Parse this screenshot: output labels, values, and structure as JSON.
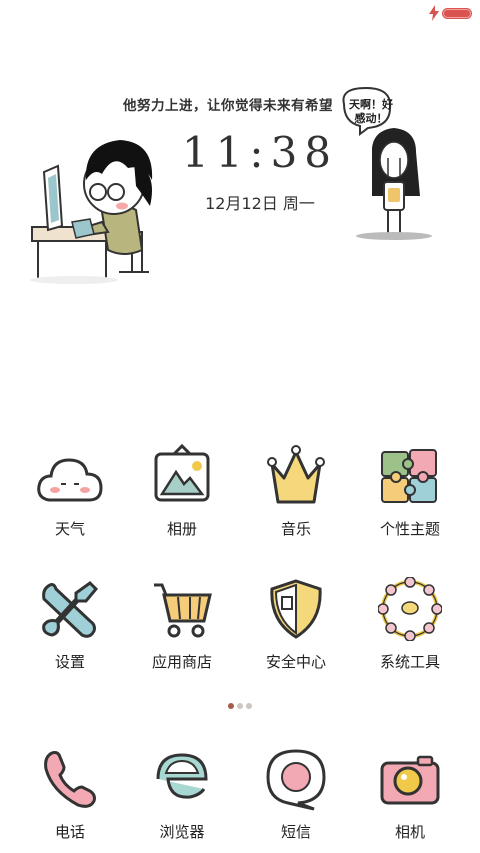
{
  "status_bar": {
    "charging": true,
    "battery_color": "#d9534f"
  },
  "widget": {
    "slogan": "他努力上进，让你觉得未来有希望",
    "time": "11:38",
    "date": "12月12日 周一",
    "bubble": "天啊！好感动！"
  },
  "apps": [
    {
      "label": "天气",
      "icon": "cloud-icon"
    },
    {
      "label": "相册",
      "icon": "photo-icon"
    },
    {
      "label": "音乐",
      "icon": "crown-icon"
    },
    {
      "label": "个性主题",
      "icon": "puzzle-icon"
    },
    {
      "label": "设置",
      "icon": "tools-icon"
    },
    {
      "label": "应用商店",
      "icon": "cart-icon"
    },
    {
      "label": "安全中心",
      "icon": "shield-icon"
    },
    {
      "label": "系统工具",
      "icon": "ring-icon"
    }
  ],
  "page_indicator": {
    "pages": 3,
    "active": 1
  },
  "dock": [
    {
      "label": "电话",
      "icon": "phone-icon"
    },
    {
      "label": "浏览器",
      "icon": "browser-icon"
    },
    {
      "label": "短信",
      "icon": "message-icon"
    },
    {
      "label": "相机",
      "icon": "camera-icon"
    }
  ]
}
